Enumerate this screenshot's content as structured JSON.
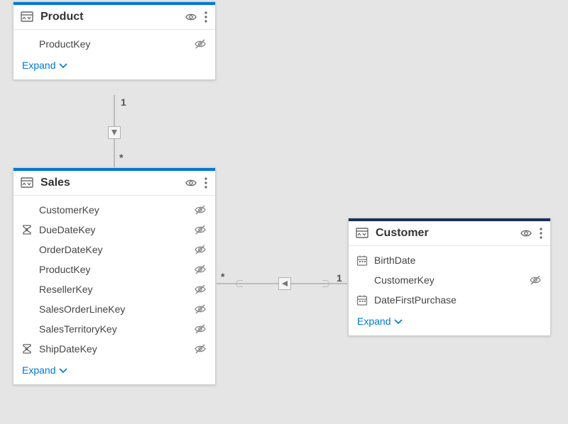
{
  "tables": {
    "product": {
      "title": "Product",
      "accent": "blue",
      "expand_label": "Expand",
      "fields": [
        {
          "name": "ProductKey",
          "icon": "none",
          "hidden": true
        }
      ]
    },
    "sales": {
      "title": "Sales",
      "accent": "blue",
      "expand_label": "Expand",
      "fields": [
        {
          "name": "CustomerKey",
          "icon": "none",
          "hidden": true
        },
        {
          "name": "DueDateKey",
          "icon": "sigma",
          "hidden": true
        },
        {
          "name": "OrderDateKey",
          "icon": "none",
          "hidden": true
        },
        {
          "name": "ProductKey",
          "icon": "none",
          "hidden": true
        },
        {
          "name": "ResellerKey",
          "icon": "none",
          "hidden": true
        },
        {
          "name": "SalesOrderLineKey",
          "icon": "none",
          "hidden": true
        },
        {
          "name": "SalesTerritoryKey",
          "icon": "none",
          "hidden": true
        },
        {
          "name": "ShipDateKey",
          "icon": "sigma",
          "hidden": true
        }
      ]
    },
    "customer": {
      "title": "Customer",
      "accent": "dark",
      "expand_label": "Expand",
      "fields": [
        {
          "name": "BirthDate",
          "icon": "date",
          "hidden": false
        },
        {
          "name": "CustomerKey",
          "icon": "none",
          "hidden": true
        },
        {
          "name": "DateFirstPurchase",
          "icon": "date",
          "hidden": false
        }
      ]
    }
  },
  "relationships": [
    {
      "from": "Product",
      "to": "Sales",
      "from_card": "1",
      "to_card": "*",
      "direction": "single"
    },
    {
      "from": "Customer",
      "to": "Sales",
      "from_card": "1",
      "to_card": "*",
      "direction": "single"
    }
  ]
}
